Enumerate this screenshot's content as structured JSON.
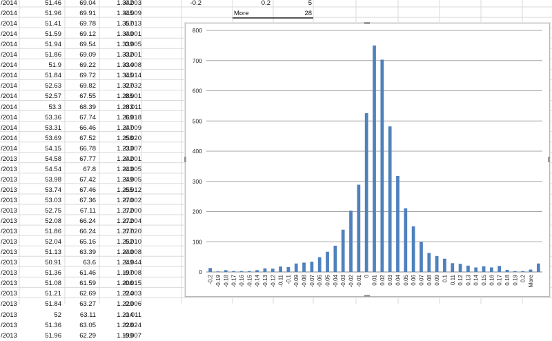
{
  "sheet": {
    "rows": [
      [
        "/2014",
        "51.46",
        "69.04",
        "1.342",
        "-0.003"
      ],
      [
        "/2014",
        "51.96",
        "69.91",
        "1.345",
        "-0.009"
      ],
      [
        "/2014",
        "51.41",
        "69.78",
        "1.357",
        "0.013"
      ],
      [
        "/2014",
        "51.59",
        "69.12",
        "1.340",
        "0.001"
      ],
      [
        "/2014",
        "51.94",
        "69.54",
        "1.339",
        "0.005"
      ],
      [
        "/2014",
        "51.86",
        "69.09",
        "1.332",
        "-0.001"
      ],
      [
        "/2014",
        "51.9",
        "69.22",
        "1.334",
        "-0.008"
      ],
      [
        "/2014",
        "51.84",
        "69.72",
        "1.345",
        "0.014"
      ],
      [
        "/2014",
        "52.63",
        "69.82",
        "1.327",
        "0.032"
      ],
      [
        "/2014",
        "52.57",
        "67.55",
        "1.285",
        "0.001"
      ],
      [
        "/2014",
        "53.3",
        "68.39",
        "1.283",
        "0.011"
      ],
      [
        "/2014",
        "53.36",
        "67.74",
        "1.269",
        "0.018"
      ],
      [
        "/2014",
        "53.31",
        "66.46",
        "1.247",
        "-0.009"
      ],
      [
        "/2014",
        "53.69",
        "67.52",
        "1.258",
        "0.020"
      ],
      [
        "/2014",
        "54.15",
        "66.78",
        "1.233",
        "-0.007"
      ],
      [
        "/2013",
        "54.58",
        "67.77",
        "1.242",
        "-0.001"
      ],
      [
        "/2013",
        "54.54",
        "67.8",
        "1.243",
        "-0.005"
      ],
      [
        "/2013",
        "53.98",
        "67.42",
        "1.249",
        "-0.005"
      ],
      [
        "/2013",
        "53.74",
        "67.46",
        "1.255",
        "-0.012"
      ],
      [
        "/2013",
        "53.03",
        "67.36",
        "1.270",
        "-0.002"
      ],
      [
        "/2013",
        "52.75",
        "67.11",
        "1.272",
        "0.000"
      ],
      [
        "/2013",
        "52.08",
        "66.24",
        "1.272",
        "-0.004"
      ],
      [
        "/2013",
        "51.86",
        "66.24",
        "1.277",
        "0.020"
      ],
      [
        "/2013",
        "52.04",
        "65.16",
        "1.252",
        "0.010"
      ],
      [
        "/2013",
        "51.13",
        "63.39",
        "1.240",
        "-0.008"
      ],
      [
        "/2013",
        "50.91",
        "63.6",
        "1.249",
        "0.044"
      ],
      [
        "/2013",
        "51.36",
        "61.46",
        "1.197",
        "-0.008"
      ],
      [
        "/2013",
        "51.08",
        "61.59",
        "1.206",
        "-0.015"
      ],
      [
        "/2013",
        "51.21",
        "62.69",
        "1.224",
        "0.003"
      ],
      [
        "/2013",
        "51.84",
        "63.27",
        "1.220",
        "0.006"
      ],
      [
        "/2013",
        "52",
        "63.11",
        "1.214",
        "-0.011"
      ],
      [
        "/2013",
        "51.36",
        "63.05",
        "1.228",
        "0.024"
      ],
      [
        "/2013",
        "51.96",
        "62.29",
        "1.199",
        "-0.007"
      ]
    ],
    "bin_table": [
      {
        "bin": "-0.2",
        "bin_label": "",
        "freq": ""
      },
      {
        "bin": "0.2",
        "bin_label": "",
        "freq": "5"
      },
      {
        "bin": "",
        "bin_label": "More",
        "freq": "28"
      }
    ]
  },
  "chart_data": {
    "type": "bar",
    "title": "",
    "xlabel": "",
    "ylabel": "",
    "ylim": [
      0,
      800
    ],
    "yticks": [
      0,
      100,
      200,
      300,
      400,
      500,
      600,
      700,
      800
    ],
    "grid": true,
    "legend": "none",
    "bar_color": "#4f81bd",
    "categories": [
      "-0.2",
      "-0.19",
      "-0.18",
      "-0.17",
      "-0.16",
      "-0.15",
      "-0.14",
      "-0.13",
      "-0.12",
      "-0.11",
      "-0.1",
      "-0.09",
      "-0.08",
      "-0.07",
      "-0.06",
      "-0.05",
      "-0.04",
      "-0.03",
      "-0.02",
      "-0.01",
      "0",
      "0.01",
      "0.02",
      "0.03",
      "0.04",
      "0.05",
      "0.06",
      "0.07",
      "0.08",
      "0.09",
      "0.1",
      "0.11",
      "0.12",
      "0.13",
      "0.14",
      "0.15",
      "0.16",
      "0.17",
      "0.18",
      "0.19",
      "0.2",
      "More"
    ],
    "values": [
      13,
      2,
      6,
      3,
      3,
      3,
      6,
      12,
      11,
      18,
      16,
      28,
      31,
      34,
      49,
      67,
      87,
      140,
      203,
      289,
      526,
      750,
      703,
      482,
      318,
      211,
      151,
      100,
      63,
      53,
      44,
      29,
      27,
      21,
      15,
      19,
      15,
      20,
      7,
      3,
      3,
      8,
      28
    ]
  }
}
